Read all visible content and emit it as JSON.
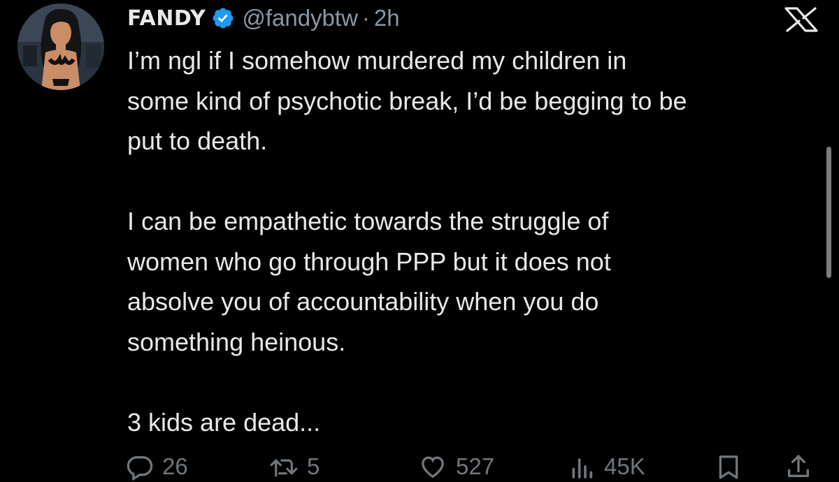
{
  "tweet": {
    "author": {
      "display_name": "FANDY",
      "handle": "@fandybtw",
      "verified": true,
      "avatar": "anime-girl-avatar"
    },
    "separator": "·",
    "timestamp": "2h",
    "platform_logo": "x-logo-icon",
    "text": "I’m ngl if I somehow murdered my children in\nsome kind of psychotic break, I’d be begging to be\nput to death.\n\nI can be empathetic towards the struggle of\nwomen who go through PPP but it does not\nabsolve you of accountability when you do\nsomething heinous.\n\n3 kids are dead...",
    "actions": {
      "replies": "26",
      "retweets": "5",
      "likes": "527",
      "views": "45K"
    }
  },
  "colors": {
    "background": "#000000",
    "text": "#e7e9ea",
    "muted": "#71767b",
    "verified": "#1d9bf0"
  }
}
